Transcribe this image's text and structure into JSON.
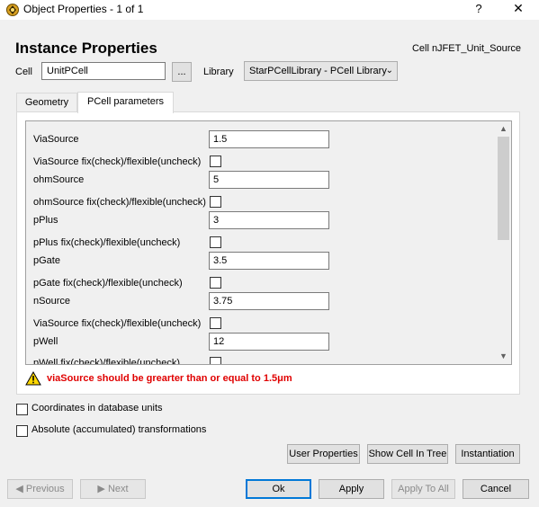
{
  "window": {
    "title": "Object Properties - 1 of 1",
    "help": "?",
    "close": "✕"
  },
  "header": {
    "title": "Instance Properties",
    "cell_name": "Cell nJFET_Unit_Source"
  },
  "cell": {
    "label": "Cell",
    "value": "UnitPCell",
    "browse_label": "..."
  },
  "library": {
    "label": "Library",
    "value": "StarPCellLibrary - PCell Library"
  },
  "tabs": [
    {
      "label": "Geometry"
    },
    {
      "label": "PCell parameters"
    }
  ],
  "params": [
    {
      "label": "ViaSource",
      "value": "1.5"
    },
    {
      "label": "ViaSource fix(check)/flexible(uncheck)",
      "checked": false
    },
    {
      "label": "ohmSource",
      "value": "5"
    },
    {
      "label": "ohmSource fix(check)/flexible(uncheck)",
      "checked": false
    },
    {
      "label": "pPlus",
      "value": "3"
    },
    {
      "label": "pPlus fix(check)/flexible(uncheck)",
      "checked": false
    },
    {
      "label": "pGate",
      "value": "3.5"
    },
    {
      "label": "pGate fix(check)/flexible(uncheck)",
      "checked": false
    },
    {
      "label": "nSource",
      "value": "3.75"
    },
    {
      "label": "ViaSource fix(check)/flexible(uncheck)",
      "checked": false
    },
    {
      "label": "pWell",
      "value": "12"
    },
    {
      "label": "pWell fix(check)/flexible(uncheck)",
      "checked": false
    }
  ],
  "warning": {
    "text": "viaSource should be grearter than or equal to 1.5μm"
  },
  "options": {
    "db_units": {
      "label": "Coordinates in database units",
      "checked": false
    },
    "abs_transform": {
      "label": "Absolute (accumulated) transformations",
      "checked": false
    }
  },
  "actions": {
    "user_properties": "User Properties",
    "show_cell": "Show Cell In Tree",
    "instantiation": "Instantiation"
  },
  "nav": {
    "previous": "◀  Previous",
    "next": "▶  Next"
  },
  "footer": {
    "ok": "Ok",
    "apply": "Apply",
    "apply_all": "Apply To All",
    "cancel": "Cancel"
  },
  "colors": {
    "warning_text": "#e00000",
    "focus_border": "#0078d7"
  }
}
